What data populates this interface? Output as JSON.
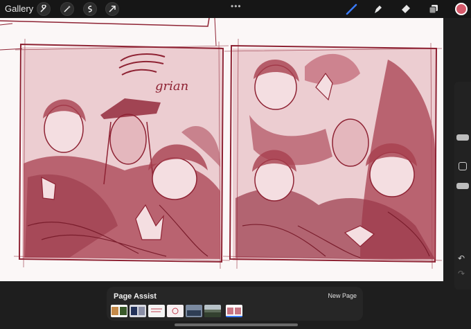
{
  "toolbar": {
    "gallery_label": "Gallery",
    "left_tools": [
      "wrench-icon",
      "magic-wand-icon",
      "selection-icon",
      "transform-arrow-icon"
    ],
    "more_label": "•••",
    "right_tools": [
      "brush-icon",
      "smudge-icon",
      "eraser-icon",
      "layers-icon"
    ],
    "current_color": "#d4596a"
  },
  "canvas": {
    "sketch_color": "#8e2233",
    "fill_color": "#e9c9cd",
    "annotation_text": "grian"
  },
  "sidebar": {
    "undo_label": "↶",
    "redo_label": "↷"
  },
  "page_assist": {
    "title": "Page Assist",
    "new_page_label": "New Page",
    "page_count": 7,
    "selected_page": 7
  }
}
